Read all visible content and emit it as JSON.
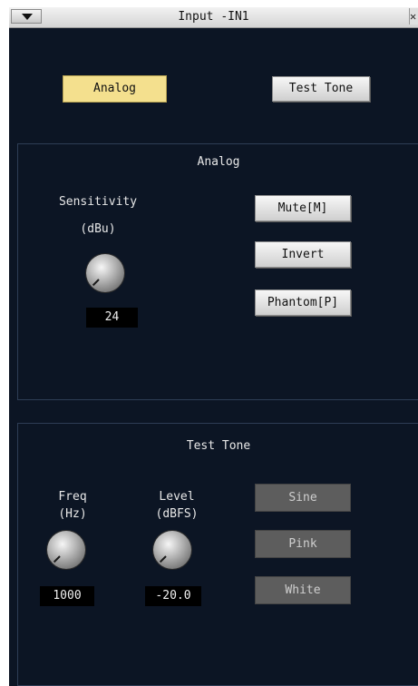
{
  "window": {
    "title": "Input -IN1"
  },
  "mode_tabs": {
    "analog": "Analog",
    "test_tone": "Test Tone"
  },
  "analog_panel": {
    "title": "Analog",
    "sensitivity_label": "Sensitivity",
    "sensitivity_unit": "(dBu)",
    "sensitivity_value": "24",
    "mute_label": "Mute[M]",
    "invert_label": "Invert",
    "phantom_label": "Phantom[P]"
  },
  "test_tone_panel": {
    "title": "Test Tone",
    "freq_label": "Freq",
    "freq_unit": "(Hz)",
    "freq_value": "1000",
    "level_label": "Level",
    "level_unit": "(dBFS)",
    "level_value": "-20.0",
    "sine_label": "Sine",
    "pink_label": "Pink",
    "white_label": "White"
  },
  "colors": {
    "background": "#0c1524",
    "selected_tab": "#f4e08e",
    "disabled_button": "#5d5d5d"
  },
  "icons": {
    "menu": "triangle-down-icon",
    "close": "close-icon"
  }
}
